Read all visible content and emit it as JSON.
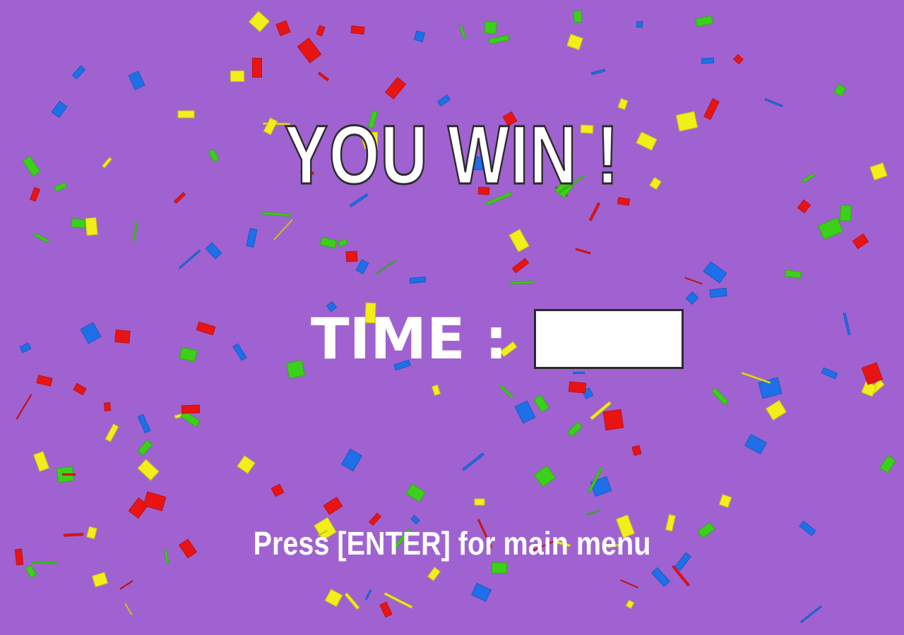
{
  "screen": {
    "background_color": "#a062d0"
  },
  "title": "YOU WIN !",
  "time": {
    "label": "TIME :",
    "value": ""
  },
  "hint": "Press [ENTER] for main menu",
  "confetti": {
    "colors": [
      "#1e6fe8",
      "#e81414",
      "#f2ee1a",
      "#3ccf1c"
    ]
  }
}
